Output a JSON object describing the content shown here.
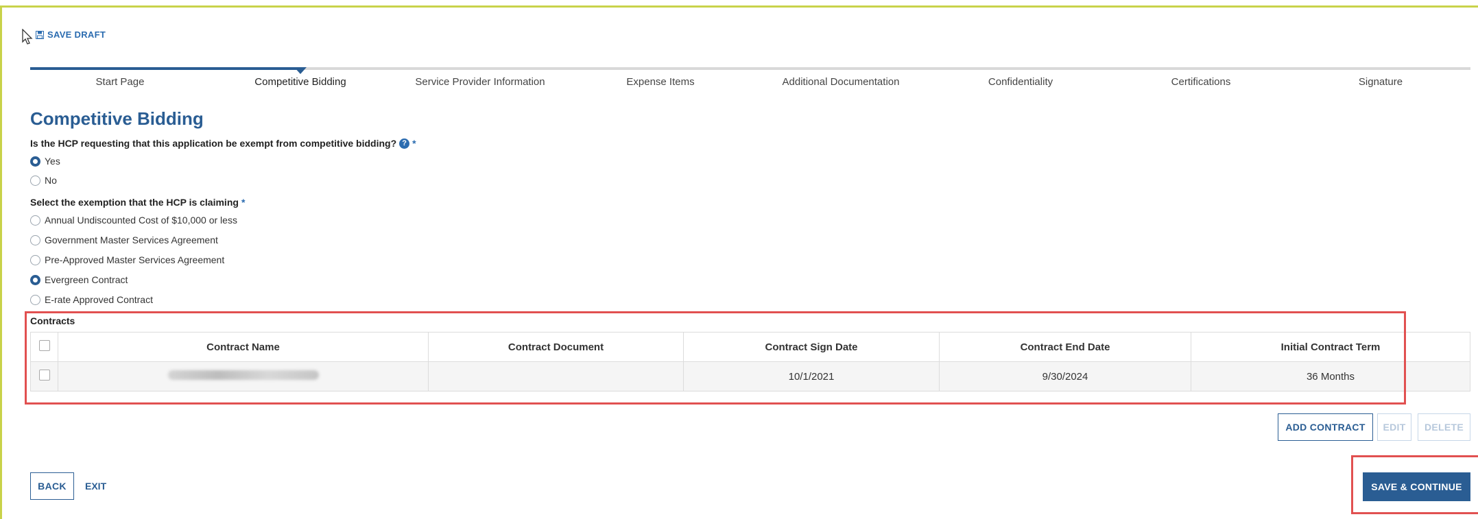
{
  "toolbar": {
    "save_draft_label": "SAVE DRAFT"
  },
  "steps": [
    {
      "label": "Start Page"
    },
    {
      "label": "Competitive Bidding"
    },
    {
      "label": "Service Provider Information"
    },
    {
      "label": "Expense Items"
    },
    {
      "label": "Additional Documentation"
    },
    {
      "label": "Confidentiality"
    },
    {
      "label": "Certifications"
    },
    {
      "label": "Signature"
    }
  ],
  "active_step": "Competitive Bidding",
  "page_title": "Competitive Bidding",
  "question_exempt": {
    "label": "Is the HCP requesting that this application be exempt from competitive bidding?",
    "required_marker": "*",
    "options": [
      "Yes",
      "No"
    ],
    "selected": "Yes"
  },
  "question_exemption": {
    "label": "Select the exemption that the HCP is claiming",
    "required_marker": "*",
    "options": [
      "Annual Undiscounted Cost of $10,000 or less",
      "Government Master Services Agreement",
      "Pre-Approved Master Services Agreement",
      "Evergreen Contract",
      "E-rate Approved Contract"
    ],
    "selected": "Evergreen Contract"
  },
  "contracts": {
    "label": "Contracts",
    "columns": [
      "Contract Name",
      "Contract Document",
      "Contract Sign Date",
      "Contract End Date",
      "Initial Contract Term"
    ],
    "rows": [
      {
        "name": "",
        "document": "",
        "sign_date": "10/1/2021",
        "end_date": "9/30/2024",
        "term": "36 Months"
      }
    ]
  },
  "table_actions": {
    "add": "ADD CONTRACT",
    "edit": "EDIT",
    "delete": "DELETE"
  },
  "footer": {
    "back": "BACK",
    "exit": "EXIT",
    "save_continue": "SAVE & CONTINUE"
  },
  "colors": {
    "primary": "#2a5d93",
    "highlight": "#e15050",
    "frame": "#c8d24a"
  }
}
